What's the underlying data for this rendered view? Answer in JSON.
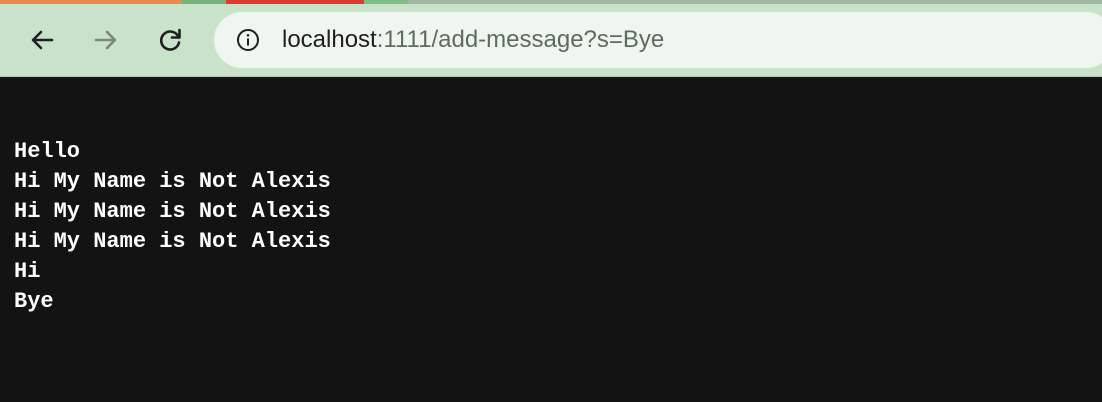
{
  "browser": {
    "address_bar": {
      "host": "localhost",
      "path": ":1111/add-message?s=Bye"
    },
    "icons": {
      "back": "arrow-left-icon",
      "forward": "arrow-right-icon",
      "reload": "reload-icon",
      "site_info": "info-circle-icon"
    }
  },
  "page": {
    "messages": [
      "Hello",
      "Hi My Name is Not Alexis",
      "Hi My Name is Not Alexis",
      "Hi My Name is Not Alexis",
      "Hi",
      "Bye"
    ]
  },
  "colors": {
    "toolbar_bg": "#c9e3cb",
    "omnibox_bg": "#eef6ef",
    "page_bg": "#131313",
    "text": "#ffffff"
  }
}
